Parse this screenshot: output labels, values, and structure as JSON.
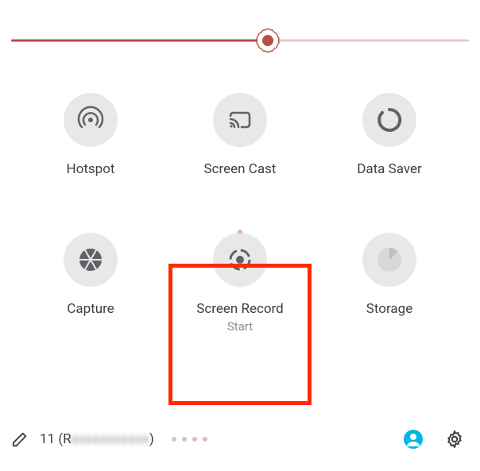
{
  "slider": {
    "percent": 56
  },
  "tiles": [
    {
      "id": "hotspot",
      "label": "Hotspot",
      "icon": "hotspot-icon"
    },
    {
      "id": "screen-cast",
      "label": "Screen Cast",
      "icon": "cast-icon"
    },
    {
      "id": "data-saver",
      "label": "Data Saver",
      "icon": "data-saver-icon"
    },
    {
      "id": "capture",
      "label": "Capture",
      "icon": "aperture-icon"
    },
    {
      "id": "screen-record",
      "label": "Screen Record",
      "sublabel": "Start",
      "icon": "record-icon",
      "highlighted": true
    },
    {
      "id": "storage",
      "label": "Storage",
      "icon": "storage-icon"
    }
  ],
  "footer": {
    "version_prefix": "11 (R",
    "version_obscured": "xxxxxxxxxxx",
    "version_suffix": ")",
    "page_dots": 4
  },
  "colors": {
    "slider_active": "#b65043",
    "slider_inactive": "#ebc8c4",
    "highlight": "#ff2a00",
    "icon_bg": "#e8e8e8",
    "account_accent": "#00b6e3"
  }
}
